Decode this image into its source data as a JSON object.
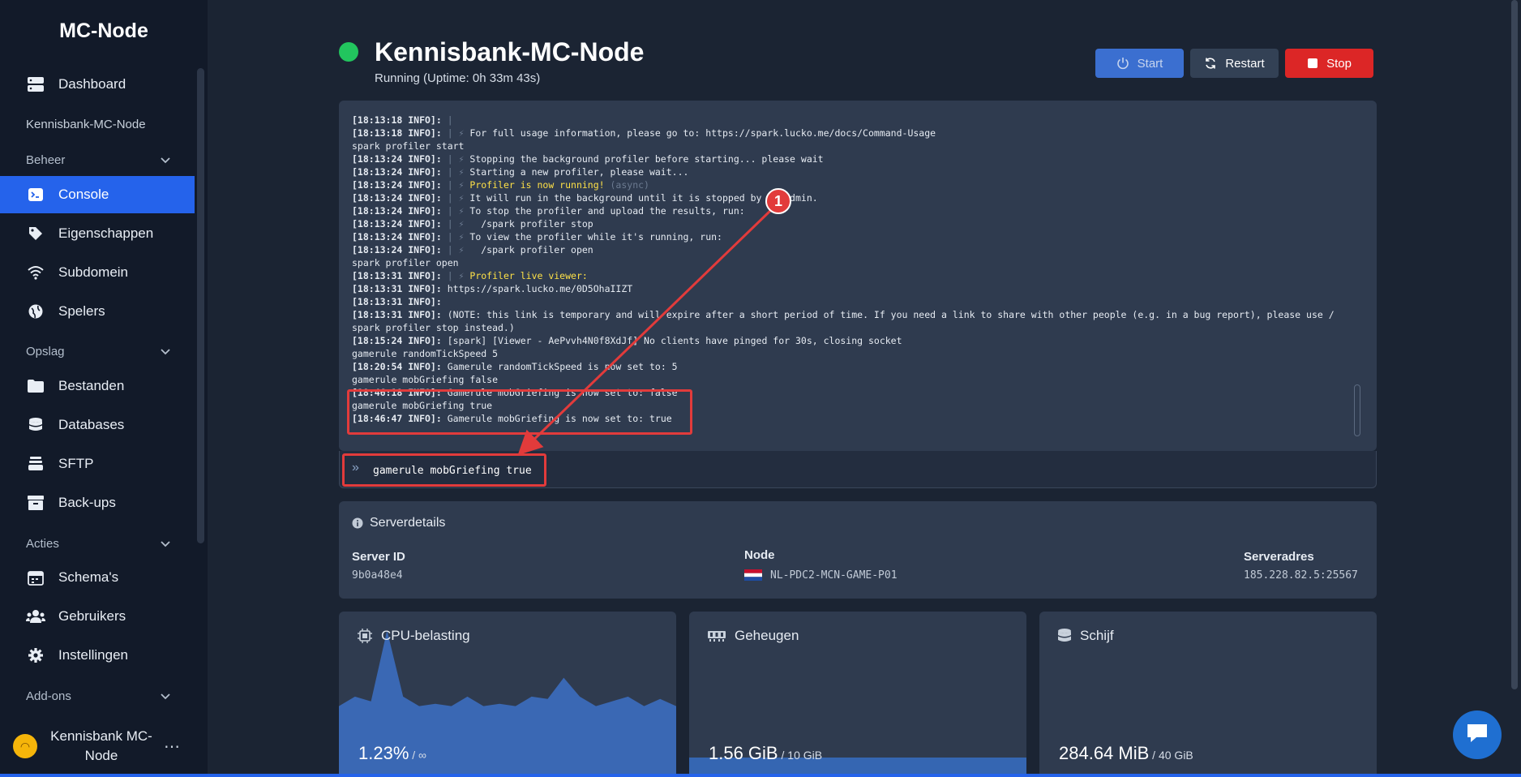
{
  "sidebar": {
    "brand": "MC-Node",
    "dashboard": "Dashboard",
    "server_name": "Kennisbank-MC-Node",
    "section_beheer": "Beheer",
    "console": "Console",
    "eigenschappen": "Eigenschappen",
    "subdomein": "Subdomein",
    "spelers": "Spelers",
    "section_opslag": "Opslag",
    "bestanden": "Bestanden",
    "databases": "Databases",
    "sftp": "SFTP",
    "backups": "Back-ups",
    "section_acties": "Acties",
    "schemas": "Schema's",
    "gebruikers": "Gebruikers",
    "instellingen": "Instellingen",
    "section_addons": "Add-ons",
    "user_name": "Kennisbank MC-Node"
  },
  "header": {
    "title": "Kennisbank-MC-Node",
    "subtitle": "Running (Uptime: 0h 33m 43s)",
    "start_label": "Start",
    "restart_label": "Restart",
    "stop_label": "Stop",
    "status_color": "#22c55e"
  },
  "console": {
    "lines": [
      {
        "ts": "[18:13:18 INFO]:",
        "pre": " | ",
        "text": ""
      },
      {
        "ts": "[18:13:18 INFO]:",
        "pre": " | ⚡ ",
        "text": "For full usage information, please go to: https://spark.lucko.me/docs/Command-Usage"
      },
      {
        "ts": "",
        "pre": "",
        "text": "spark profiler start"
      },
      {
        "ts": "[18:13:24 INFO]:",
        "pre": " | ⚡ ",
        "text": "Stopping the background profiler before starting... please wait"
      },
      {
        "ts": "[18:13:24 INFO]:",
        "pre": " | ⚡ ",
        "text": "Starting a new profiler, please wait..."
      },
      {
        "ts": "[18:13:24 INFO]:",
        "pre": " | ⚡ ",
        "text": "Profiler is now running!",
        "style": "yellow",
        "suffix": " (async)"
      },
      {
        "ts": "[18:13:24 INFO]:",
        "pre": " | ⚡ ",
        "text": "It will run in the background until it is stopped by an admin."
      },
      {
        "ts": "[18:13:24 INFO]:",
        "pre": " | ⚡ ",
        "text": "To stop the profiler and upload the results, run:"
      },
      {
        "ts": "[18:13:24 INFO]:",
        "pre": " | ⚡ ",
        "text": "  /spark profiler stop"
      },
      {
        "ts": "[18:13:24 INFO]:",
        "pre": " | ⚡ ",
        "text": "To view the profiler while it's running, run:"
      },
      {
        "ts": "[18:13:24 INFO]:",
        "pre": " | ⚡ ",
        "text": "  /spark profiler open"
      },
      {
        "ts": "",
        "pre": "",
        "text": "spark profiler open"
      },
      {
        "ts": "[18:13:31 INFO]:",
        "pre": " | ⚡ ",
        "text": "Profiler live viewer:",
        "style": "yellow"
      },
      {
        "ts": "[18:13:31 INFO]:",
        "pre": " ",
        "text": "https://spark.lucko.me/0D5OhaIIZT"
      },
      {
        "ts": "[18:13:31 INFO]:",
        "pre": "",
        "text": ""
      },
      {
        "ts": "[18:13:31 INFO]:",
        "pre": " ",
        "text": "(NOTE: this link is temporary and will expire after a short period of time. If you need a link to share with other people (e.g. in a bug report), please use /"
      },
      {
        "ts": "",
        "pre": "",
        "text": "spark profiler stop instead.)"
      },
      {
        "ts": "[18:15:24 INFO]:",
        "pre": " ",
        "text": "[spark] [Viewer - AePvvh4N0f8XdJf] No clients have pinged for 30s, closing socket"
      },
      {
        "ts": "",
        "pre": "",
        "text": "gamerule randomTickSpeed 5"
      },
      {
        "ts": "[18:20:54 INFO]:",
        "pre": " ",
        "text": "Gamerule randomTickSpeed is now set to: 5"
      },
      {
        "ts": "",
        "pre": "",
        "text": "gamerule mobGriefing false"
      },
      {
        "ts": "[18:46:18 INFO]:",
        "pre": " ",
        "text": "Gamerule mobGriefing is now set to: false"
      },
      {
        "ts": "",
        "pre": "",
        "text": "gamerule mobGriefing true"
      },
      {
        "ts": "[18:46:47 INFO]:",
        "pre": " ",
        "text": "Gamerule mobGriefing is now set to: true"
      }
    ],
    "prompt_symbol": "»",
    "input_value": "gamerule mobGriefing true"
  },
  "details": {
    "title": "Serverdetails",
    "server_id_label": "Server ID",
    "server_id": "9b0a48e4",
    "node_label": "Node",
    "node": "NL-PDC2-MCN-GAME-P01",
    "address_label": "Serveradres",
    "address": "185.228.82.5:25567"
  },
  "stats": {
    "cpu_title": "CPU-belasting",
    "cpu_value": "1.23%",
    "cpu_max": " / ∞",
    "cpu_history": [
      30,
      34,
      32,
      62,
      34,
      30,
      31,
      30,
      34,
      30,
      31,
      30,
      34,
      33,
      42,
      34,
      30,
      32,
      34,
      30,
      33,
      30
    ],
    "mem_title": "Geheugen",
    "mem_value": "1.56 GiB",
    "mem_max": " / 10 GiB",
    "mem_fraction": 0.156,
    "disk_title": "Schijf",
    "disk_value": "284.64 MiB",
    "disk_max": " / 40 GiB"
  },
  "annotation": {
    "badge": "1",
    "color": "#e23b3b"
  }
}
